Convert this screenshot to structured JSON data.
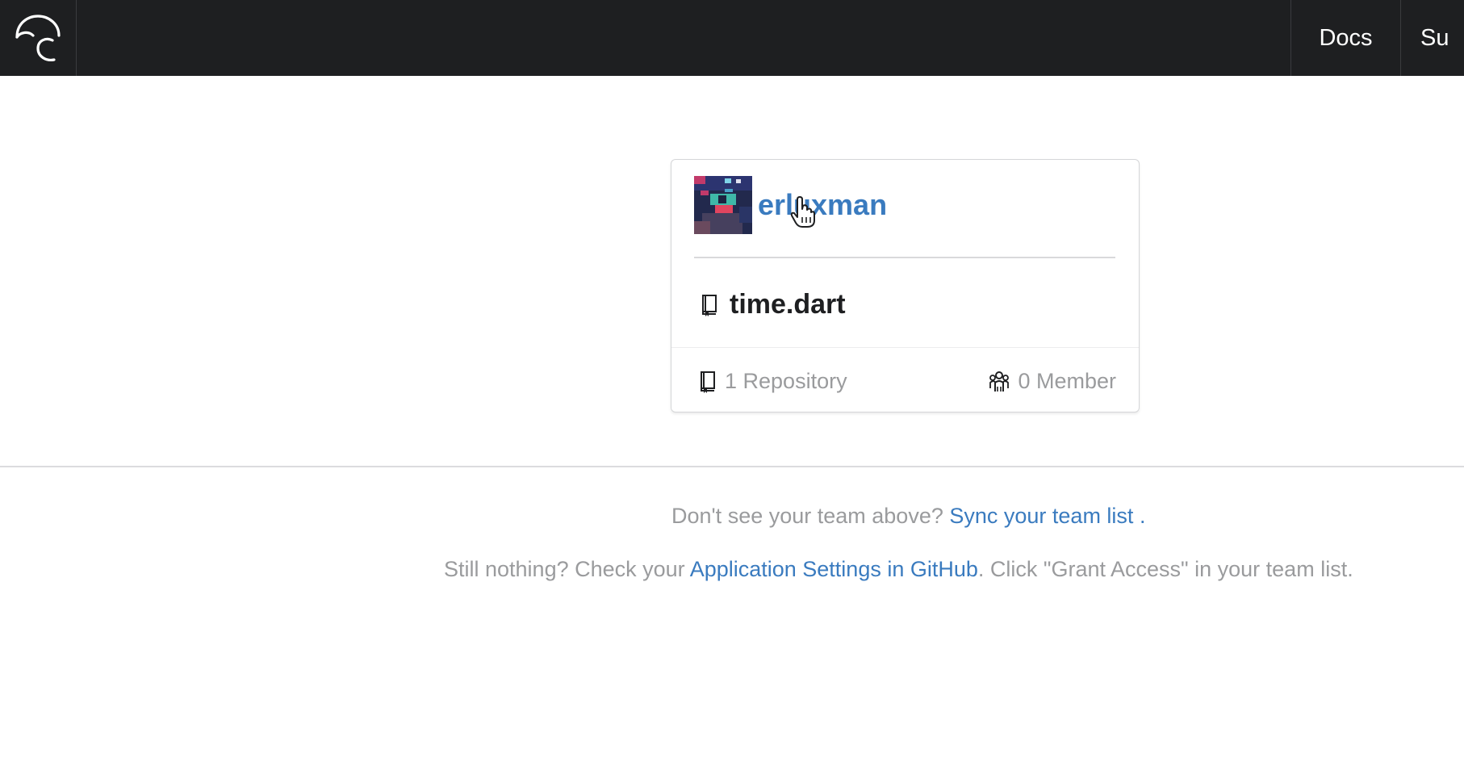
{
  "nav": {
    "docs_label": "Docs",
    "support_label_partial": "Su"
  },
  "team_card": {
    "name": "erluxman",
    "repository_name": "time.dart",
    "repository_count_label": "1 Repository",
    "member_count_label": "0 Member",
    "icons": {
      "repo": "book-icon",
      "members": "team-icon"
    }
  },
  "help": {
    "line1_prefix": "Don't see your team above? ",
    "line1_link": "Sync your team list",
    "line1_suffix": " .",
    "line2_prefix": "Still nothing? Check your ",
    "line2_link": "Application Settings in GitHub",
    "line2_suffix": ". Click \"Grant Access\" in your team list."
  },
  "colors": {
    "topbar": "#1e1f21",
    "link": "#3a7bbf",
    "muted_text": "#9a9b9d"
  }
}
